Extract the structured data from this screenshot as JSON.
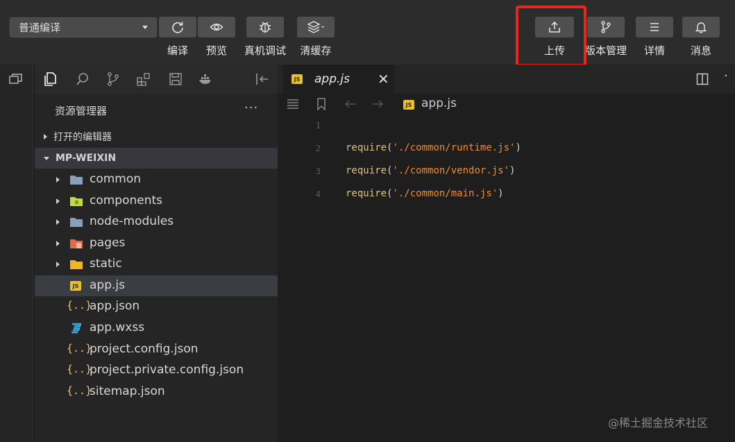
{
  "toolbar": {
    "compile_mode": "普通编译",
    "buttons": {
      "compile": "编译",
      "preview": "预览",
      "remote_debug": "真机调试",
      "clear_cache": "清缓存",
      "upload": "上传",
      "version_mgmt": "版本管理",
      "details": "详情",
      "messages": "消息"
    },
    "highlight_color": "#e8271c"
  },
  "explorer": {
    "title": "资源管理器",
    "more": "···",
    "open_editors": "打开的编辑器",
    "project": "MP-WEIXIN",
    "items": [
      {
        "name": "common",
        "type": "folder",
        "icon": "folder-icon"
      },
      {
        "name": "components",
        "type": "folder",
        "icon": "components-folder-icon"
      },
      {
        "name": "node-modules",
        "type": "folder",
        "icon": "folder-icon"
      },
      {
        "name": "pages",
        "type": "folder",
        "icon": "pages-folder-icon"
      },
      {
        "name": "static",
        "type": "folder",
        "icon": "static-folder-icon"
      },
      {
        "name": "app.js",
        "type": "file",
        "icon": "js-file-icon",
        "selected": true
      },
      {
        "name": "app.json",
        "type": "file",
        "icon": "json-file-icon"
      },
      {
        "name": "app.wxss",
        "type": "file",
        "icon": "css-file-icon"
      },
      {
        "name": "project.config.json",
        "type": "file",
        "icon": "json-file-icon"
      },
      {
        "name": "project.private.config.json",
        "type": "file",
        "icon": "json-file-icon"
      },
      {
        "name": "sitemap.json",
        "type": "file",
        "icon": "json-file-icon"
      }
    ]
  },
  "editor": {
    "tab_label": "app.js",
    "breadcrumb_file": "app.js",
    "js_badge": "JS",
    "json_glyph": "{..}",
    "lines": [
      {
        "n": "1",
        "kw": "",
        "open": "",
        "str": "",
        "close": ""
      },
      {
        "n": "2",
        "kw": "require",
        "open": "(",
        "str": "'./common/runtime.js'",
        "close": ")"
      },
      {
        "n": "3",
        "kw": "require",
        "open": "(",
        "str": "'./common/vendor.js'",
        "close": ")"
      },
      {
        "n": "4",
        "kw": "require",
        "open": "(",
        "str": "'./common/main.js'",
        "close": ")"
      }
    ]
  },
  "watermark": "@稀土掘金技术社区"
}
